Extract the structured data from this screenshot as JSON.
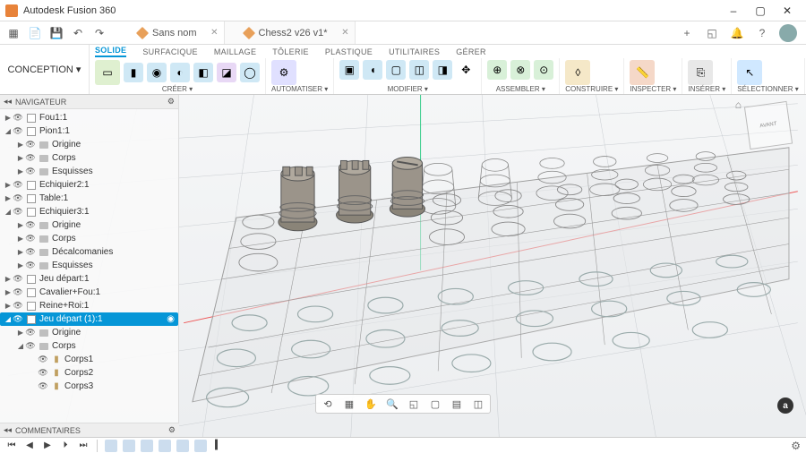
{
  "app": {
    "title": "Autodesk Fusion 360"
  },
  "window": {
    "minimize": "–",
    "maximize": "▢",
    "close": "✕"
  },
  "tabs": [
    {
      "label": "Sans nom",
      "active": false
    },
    {
      "label": "Chess2 v26 v1*",
      "active": true
    }
  ],
  "topright_icons": [
    "plus",
    "extensions",
    "notifications",
    "help",
    "account"
  ],
  "concept_btn": "CONCEPTION ▾",
  "ribbon_tabs": [
    "SOLIDE",
    "SURFACIQUE",
    "MAILLAGE",
    "TÔLERIE",
    "PLASTIQUE",
    "UTILITAIRES",
    "GÉRER"
  ],
  "ribbon_active_tab": "SOLIDE",
  "ribbon_groups": [
    {
      "label": "CRÉER ▾"
    },
    {
      "label": "AUTOMATISER ▾"
    },
    {
      "label": "MODIFIER ▾"
    },
    {
      "label": "ASSEMBLER ▾"
    },
    {
      "label": "CONSTRUIRE ▾"
    },
    {
      "label": "INSPECTER ▾"
    },
    {
      "label": "INSÉRER ▾"
    },
    {
      "label": "SÉLECTIONNER ▾"
    }
  ],
  "browser": {
    "title": "NAVIGATEUR",
    "nodes": [
      {
        "depth": 0,
        "tw": "▶",
        "icon": "comp",
        "label": "Fou1:1"
      },
      {
        "depth": 0,
        "tw": "◢",
        "icon": "comp",
        "label": "Pion1:1"
      },
      {
        "depth": 1,
        "tw": "▶",
        "icon": "fold",
        "label": "Origine"
      },
      {
        "depth": 1,
        "tw": "▶",
        "icon": "fold",
        "label": "Corps"
      },
      {
        "depth": 1,
        "tw": "▶",
        "icon": "fold",
        "label": "Esquisses"
      },
      {
        "depth": 0,
        "tw": "▶",
        "icon": "comp",
        "label": "Echiquier2:1"
      },
      {
        "depth": 0,
        "tw": "▶",
        "icon": "comp",
        "label": "Table:1"
      },
      {
        "depth": 0,
        "tw": "◢",
        "icon": "comp",
        "label": "Echiquier3:1"
      },
      {
        "depth": 1,
        "tw": "▶",
        "icon": "fold",
        "label": "Origine"
      },
      {
        "depth": 1,
        "tw": "▶",
        "icon": "fold",
        "label": "Corps"
      },
      {
        "depth": 1,
        "tw": "▶",
        "icon": "fold",
        "label": "Décalcomanies"
      },
      {
        "depth": 1,
        "tw": "▶",
        "icon": "fold",
        "label": "Esquisses"
      },
      {
        "depth": 0,
        "tw": "▶",
        "icon": "comp",
        "label": "Jeu départ:1"
      },
      {
        "depth": 0,
        "tw": "▶",
        "icon": "comp",
        "label": "Cavalier+Fou:1"
      },
      {
        "depth": 0,
        "tw": "▶",
        "icon": "comp",
        "label": "Reine+Roi:1"
      },
      {
        "depth": 0,
        "tw": "◢",
        "icon": "comp",
        "label": "Jeu départ (1):1",
        "selected": true,
        "radio": true
      },
      {
        "depth": 1,
        "tw": "▶",
        "icon": "fold",
        "label": "Origine"
      },
      {
        "depth": 1,
        "tw": "◢",
        "icon": "fold",
        "label": "Corps"
      },
      {
        "depth": 2,
        "tw": "",
        "icon": "body",
        "label": "Corps1"
      },
      {
        "depth": 2,
        "tw": "",
        "icon": "body",
        "label": "Corps2"
      },
      {
        "depth": 2,
        "tw": "",
        "icon": "body",
        "label": "Corps3"
      }
    ]
  },
  "comments": {
    "title": "COMMENTAIRES"
  },
  "viewcube": {
    "face": "AVANT"
  },
  "brand": "a",
  "viewbar_icons": [
    "orbit",
    "look",
    "pan",
    "zoom",
    "fit",
    "display",
    "grid",
    "viewports"
  ],
  "timeline": {
    "play": [
      "⏮",
      "◀",
      "▶",
      "⏵",
      "⏭"
    ],
    "features": 6
  }
}
